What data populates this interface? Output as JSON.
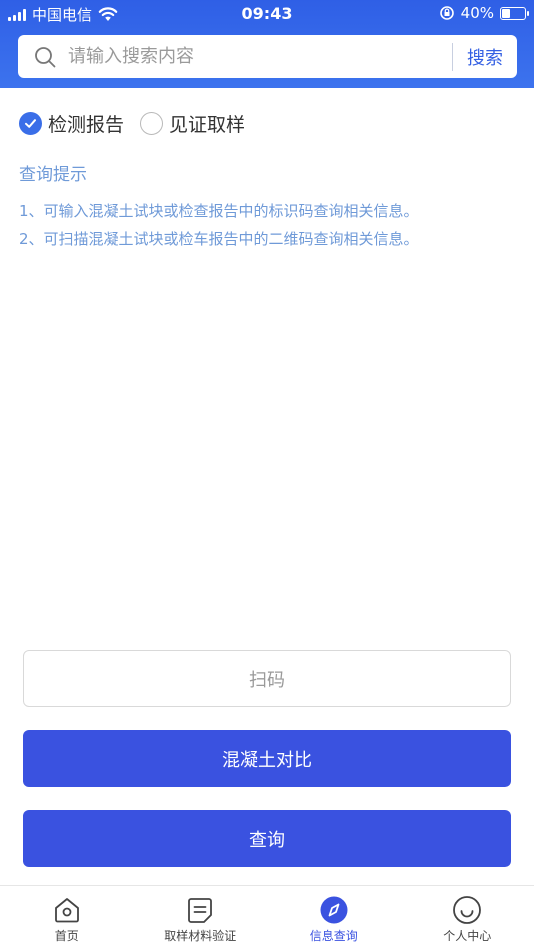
{
  "status_bar": {
    "carrier": "中国电信",
    "time": "09:43",
    "battery_percent": "40%",
    "battery_level": 0.4
  },
  "search": {
    "placeholder": "请输入搜索内容",
    "value": "",
    "button_label": "搜索",
    "icon": "search-icon"
  },
  "report_type": {
    "options": [
      {
        "label": "检测报告",
        "checked": true
      },
      {
        "label": "见证取样",
        "checked": false
      }
    ]
  },
  "tips": {
    "title": "查询提示",
    "lines": [
      "1、可输入混凝土试块或检查报告中的标识码查询相关信息。",
      "2、可扫描混凝土试块或检车报告中的二维码查询相关信息。"
    ]
  },
  "actions": {
    "scan_label": "扫码",
    "compare_label": "混凝土对比",
    "query_label": "查询"
  },
  "tabbar": {
    "items": [
      {
        "label": "首页",
        "icon": "home-icon",
        "active": false
      },
      {
        "label": "取样材料验证",
        "icon": "document-icon",
        "active": false
      },
      {
        "label": "信息查询",
        "icon": "compass-icon",
        "active": true
      },
      {
        "label": "个人中心",
        "icon": "smiley-icon",
        "active": false
      }
    ]
  },
  "colors": {
    "header": "#3366e8",
    "primary_button": "#3a52e0",
    "tips_text": "#6f9ad8",
    "active_tab": "#3a52e0"
  }
}
